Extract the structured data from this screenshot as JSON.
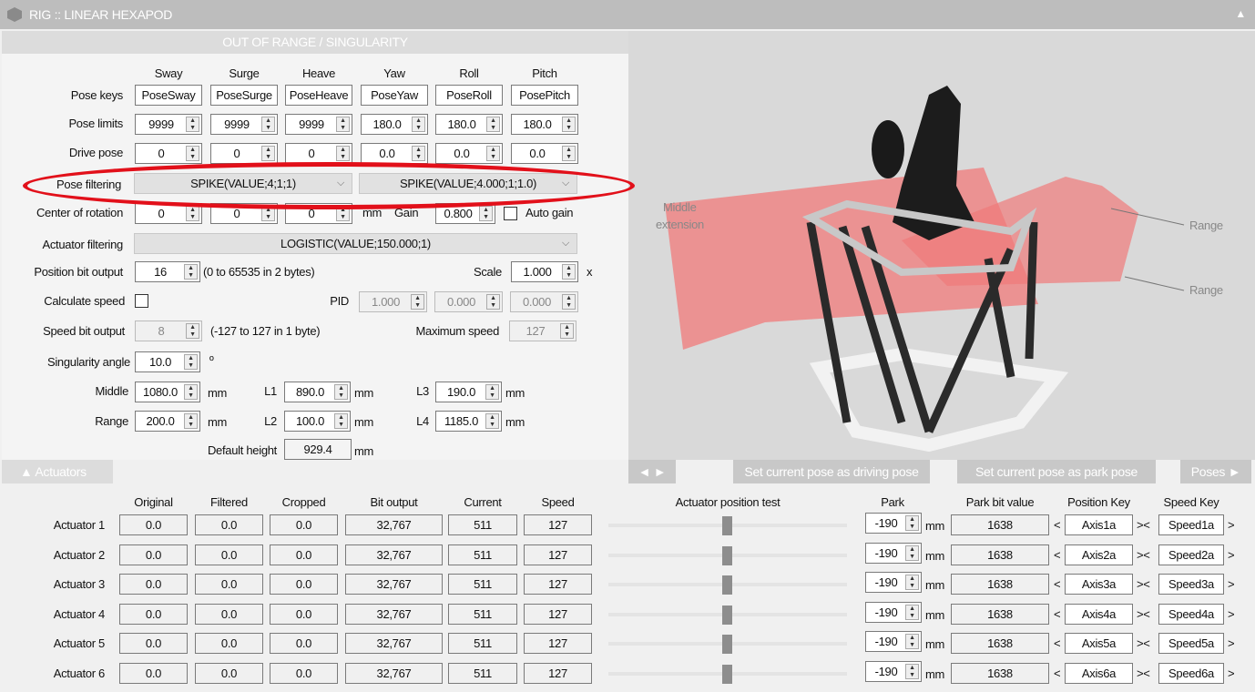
{
  "window": {
    "title": "RIG :: LINEAR HEXAPOD",
    "collapse_icon": "triangle-up-icon"
  },
  "warning": "OUT OF RANGE / SINGULARITY",
  "pose": {
    "columns": [
      "Sway",
      "Surge",
      "Heave",
      "Yaw",
      "Roll",
      "Pitch"
    ],
    "keys_label": "Pose keys",
    "keys": [
      "PoseSway",
      "PoseSurge",
      "PoseHeave",
      "PoseYaw",
      "PoseRoll",
      "PosePitch"
    ],
    "limits_label": "Pose limits",
    "limits": [
      "9999",
      "9999",
      "9999",
      "180.0",
      "180.0",
      "180.0"
    ],
    "drive_label": "Drive pose",
    "drive": [
      "0",
      "0",
      "0",
      "0.0",
      "0.0",
      "0.0"
    ],
    "filtering_label": "Pose filtering",
    "filtering": [
      "SPIKE(VALUE;4;1;1)",
      "SPIKE(VALUE;4.000;1;1.0)"
    ],
    "center_label": "Center of rotation",
    "center": [
      "0",
      "0",
      "0"
    ],
    "center_unit": "mm",
    "gain_label": "Gain",
    "gain": "0.800",
    "auto_gain_label": "Auto gain",
    "auto_gain": false
  },
  "actuator_filtering": {
    "label": "Actuator filtering",
    "value": "LOGISTIC(VALUE;150.000;1)"
  },
  "position_bit": {
    "label": "Position bit output",
    "value": "16",
    "note": "(0 to 65535 in 2 bytes)",
    "scale_label": "Scale",
    "scale": "1.000",
    "scale_unit": "x"
  },
  "calc_speed": {
    "label": "Calculate speed",
    "checked": false,
    "pid_label": "PID",
    "pid": [
      "1.000",
      "0.000",
      "0.000"
    ]
  },
  "speed_bit": {
    "label": "Speed bit output",
    "value": "8",
    "note": "(-127 to 127 in 1 byte)",
    "max_label": "Maximum speed",
    "max": "127"
  },
  "singularity": {
    "label": "Singularity angle",
    "value": "10.0",
    "unit": "º"
  },
  "geometry": {
    "middle_label": "Middle",
    "middle": "1080.0",
    "range_label": "Range",
    "range": "200.0",
    "l1_label": "L1",
    "l1": "890.0",
    "l2_label": "L2",
    "l2": "100.0",
    "l3_label": "L3",
    "l3": "190.0",
    "l4_label": "L4",
    "l4": "1185.0",
    "unit": "mm",
    "default_height_label": "Default height",
    "default_height": "929.4"
  },
  "render_labels": {
    "middle_extension": "Middle\nextension",
    "range1": "Range",
    "range2": "Range"
  },
  "toolbar": {
    "actuators": "▲  Actuators",
    "nav": "◄  ►",
    "set_driving": "Set current pose as driving pose",
    "set_park": "Set current pose as park pose",
    "poses": "Poses  ►"
  },
  "actuators": {
    "headers": [
      "Original",
      "Filtered",
      "Cropped",
      "Bit output",
      "Current",
      "Speed",
      "Actuator position test",
      "Park",
      "Park bit value",
      "Position Key",
      "Speed Key"
    ],
    "park_unit": "mm",
    "rows": [
      {
        "name": "Actuator 1",
        "original": "0.0",
        "filtered": "0.0",
        "cropped": "0.0",
        "bit": "32,767",
        "current": "511",
        "speed": "127",
        "test": 0.5,
        "park": "-190",
        "park_bit": "1638",
        "pos_key": "Axis1a",
        "speed_key": "Speed1a"
      },
      {
        "name": "Actuator 2",
        "original": "0.0",
        "filtered": "0.0",
        "cropped": "0.0",
        "bit": "32,767",
        "current": "511",
        "speed": "127",
        "test": 0.5,
        "park": "-190",
        "park_bit": "1638",
        "pos_key": "Axis2a",
        "speed_key": "Speed2a"
      },
      {
        "name": "Actuator 3",
        "original": "0.0",
        "filtered": "0.0",
        "cropped": "0.0",
        "bit": "32,767",
        "current": "511",
        "speed": "127",
        "test": 0.5,
        "park": "-190",
        "park_bit": "1638",
        "pos_key": "Axis3a",
        "speed_key": "Speed3a"
      },
      {
        "name": "Actuator 4",
        "original": "0.0",
        "filtered": "0.0",
        "cropped": "0.0",
        "bit": "32,767",
        "current": "511",
        "speed": "127",
        "test": 0.5,
        "park": "-190",
        "park_bit": "1638",
        "pos_key": "Axis4a",
        "speed_key": "Speed4a"
      },
      {
        "name": "Actuator 5",
        "original": "0.0",
        "filtered": "0.0",
        "cropped": "0.0",
        "bit": "32,767",
        "current": "511",
        "speed": "127",
        "test": 0.5,
        "park": "-190",
        "park_bit": "1638",
        "pos_key": "Axis5a",
        "speed_key": "Speed5a"
      },
      {
        "name": "Actuator 6",
        "original": "0.0",
        "filtered": "0.0",
        "cropped": "0.0",
        "bit": "32,767",
        "current": "511",
        "speed": "127",
        "test": 0.5,
        "park": "-190",
        "park_bit": "1638",
        "pos_key": "Axis6a",
        "speed_key": "Speed6a"
      }
    ]
  },
  "colors": {
    "highlight_ellipse": "#e2101a",
    "range_plane": "#f07a7a"
  }
}
